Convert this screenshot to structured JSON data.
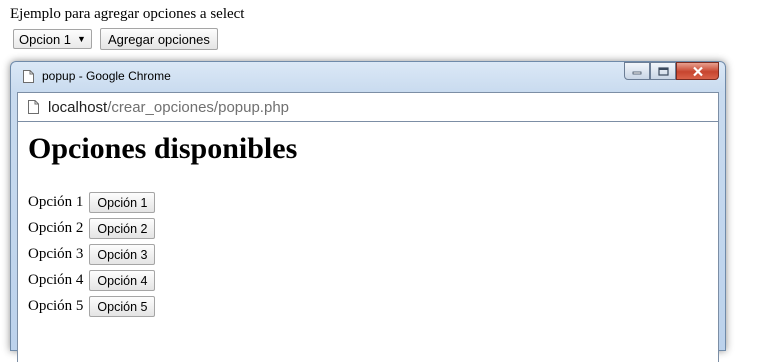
{
  "page": {
    "heading_text": "Ejemplo para agregar opciones a select",
    "select_value": "Opcion 1",
    "add_button": "Agregar opciones"
  },
  "popup": {
    "title": "popup - Google Chrome",
    "url_host": "localhost",
    "url_path": "/crear_opciones/popup.php",
    "heading": "Opciones disponibles",
    "options": [
      {
        "label": "Opción 1",
        "button": "Opción 1"
      },
      {
        "label": "Opción 2",
        "button": "Opción 2"
      },
      {
        "label": "Opción 3",
        "button": "Opción 3"
      },
      {
        "label": "Opción 4",
        "button": "Opción 4"
      },
      {
        "label": "Opción 5",
        "button": "Opción 5"
      }
    ]
  },
  "colors": {
    "titlebar": "#c9dbef",
    "close_button": "#c7452f"
  },
  "icons": [
    "document-icon",
    "minimize-icon",
    "maximize-icon",
    "close-icon",
    "chevron-down-icon"
  ]
}
